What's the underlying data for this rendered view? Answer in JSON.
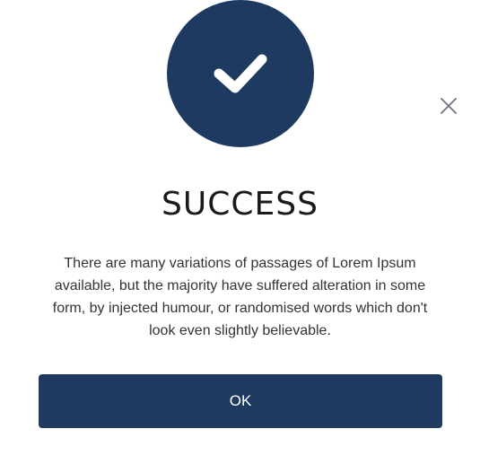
{
  "dialog": {
    "icon": "checkmark-icon",
    "close_icon": "close-icon",
    "title": "SUCCESS",
    "message": "There are many variations of passages of Lorem Ipsum available, but the majority have suffered alteration in some form, by injected humour, or randomised words which don't look even slightly believable.",
    "ok_label": "OK"
  },
  "colors": {
    "accent": "#1f3a60",
    "background": "#ffffff",
    "text": "#333333"
  }
}
